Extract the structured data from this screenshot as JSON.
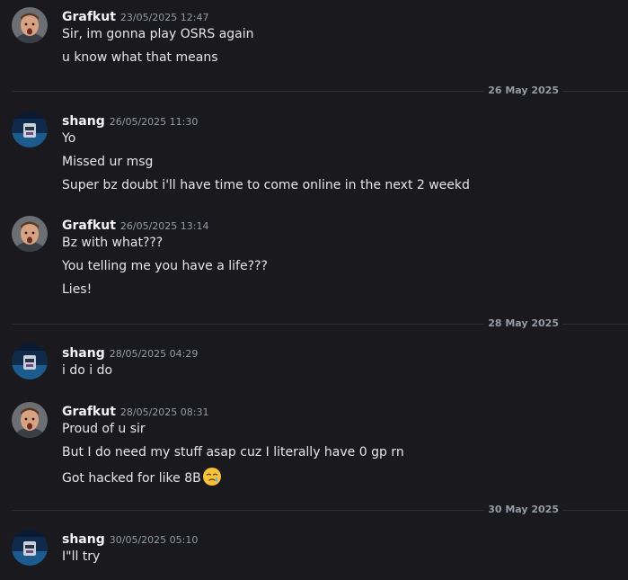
{
  "messages": [
    {
      "author": "Grafkut",
      "timestamp": "23/05/2025 12:47",
      "lines": [
        "Sir, im gonna play OSRS again",
        "u know what that means"
      ]
    },
    {
      "author": "shang",
      "timestamp": "26/05/2025 11:30",
      "lines": [
        "Yo",
        "Missed ur msg",
        "Super bz doubt i'll have time to come online in the next 2 weekd"
      ]
    },
    {
      "author": "Grafkut",
      "timestamp": "26/05/2025 13:14",
      "lines": [
        "Bz with what???",
        "You telling me you have a life???",
        "Lies!"
      ]
    },
    {
      "author": "shang",
      "timestamp": "28/05/2025 04:29",
      "lines": [
        "i do i do"
      ]
    },
    {
      "author": "Grafkut",
      "timestamp": "28/05/2025 08:31",
      "lines": [
        "Proud of u sir",
        "But I do need my stuff asap cuz I literally have 0 gp rn",
        "Got hacked for like 8B"
      ]
    },
    {
      "author": "shang",
      "timestamp": "30/05/2025 05:10",
      "lines": [
        "I\"ll try"
      ]
    }
  ],
  "dividers": [
    "26 May 2025",
    "28 May 2025",
    "30 May 2025"
  ],
  "emoji": {
    "name": "face-holding-back-tears-icon",
    "color": "#f5c33b"
  },
  "colors": {
    "background": "#1a1a1e",
    "username": "#f2f3f5",
    "timestamp": "#949ba4",
    "text": "#e4e6e8",
    "divider": "#2e2f34"
  }
}
